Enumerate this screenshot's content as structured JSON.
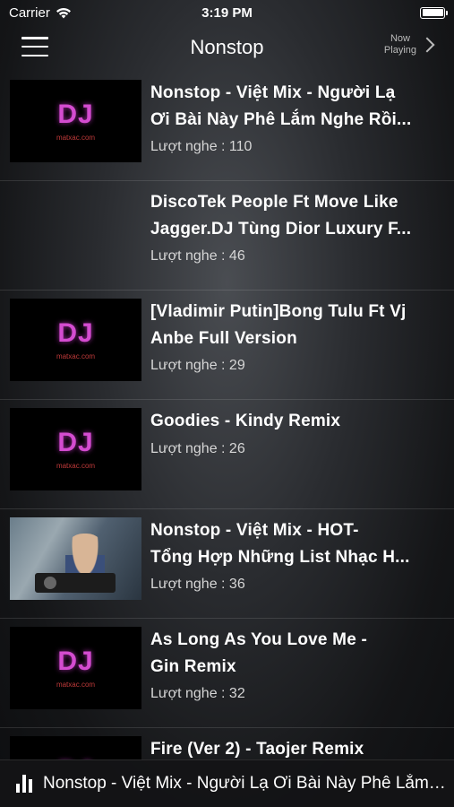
{
  "status": {
    "carrier": "Carrier",
    "time": "3:19 PM"
  },
  "nav": {
    "title": "Nonstop",
    "now_playing_line1": "Now",
    "now_playing_line2": "Playing"
  },
  "tracks": [
    {
      "title_line1": "Nonstop - Việt Mix - Người Lạ",
      "title_line2": "Ơi Bài Này Phê Lắm Nghe Rồi...",
      "plays": "Lượt nghe : 110",
      "thumb": "dj-logo"
    },
    {
      "title_line1": "DiscoTek People Ft Move Like",
      "title_line2": "Jagger.DJ Tùng Dior Luxury F...",
      "plays": "Lượt nghe : 46",
      "thumb": "none"
    },
    {
      "title_line1": "[Vladimir Putin]Bong Tulu Ft Vj",
      "title_line2": "Anbe Full Version",
      "plays": "Lượt nghe : 29",
      "thumb": "dj-logo"
    },
    {
      "title_line1": "Goodies - Kindy Remix",
      "title_line2": "",
      "plays": "Lượt nghe : 26",
      "thumb": "dj-logo"
    },
    {
      "title_line1": "Nonstop - Việt Mix - HOT-",
      "title_line2": "Tổng Hợp Những List Nhạc H...",
      "plays": "Lượt nghe : 36",
      "thumb": "photo"
    },
    {
      "title_line1": "As Long As You Love Me -",
      "title_line2": "Gin Remix",
      "plays": "Lượt nghe : 32",
      "thumb": "dj-logo"
    },
    {
      "title_line1": "Fire (Ver 2) - Taojer Remix",
      "title_line2": "",
      "plays": "",
      "thumb": "dj-logo"
    }
  ],
  "thumb_logo": {
    "text": "DJ",
    "sub": "matxac.com"
  },
  "mini_player": {
    "title": "Nonstop - Việt Mix - Người Lạ Ơi Bài Này Phê Lắm Nghe Rồi..."
  },
  "colors": {
    "logo_magenta": "#d44cd0",
    "background": "#2a2c30"
  }
}
